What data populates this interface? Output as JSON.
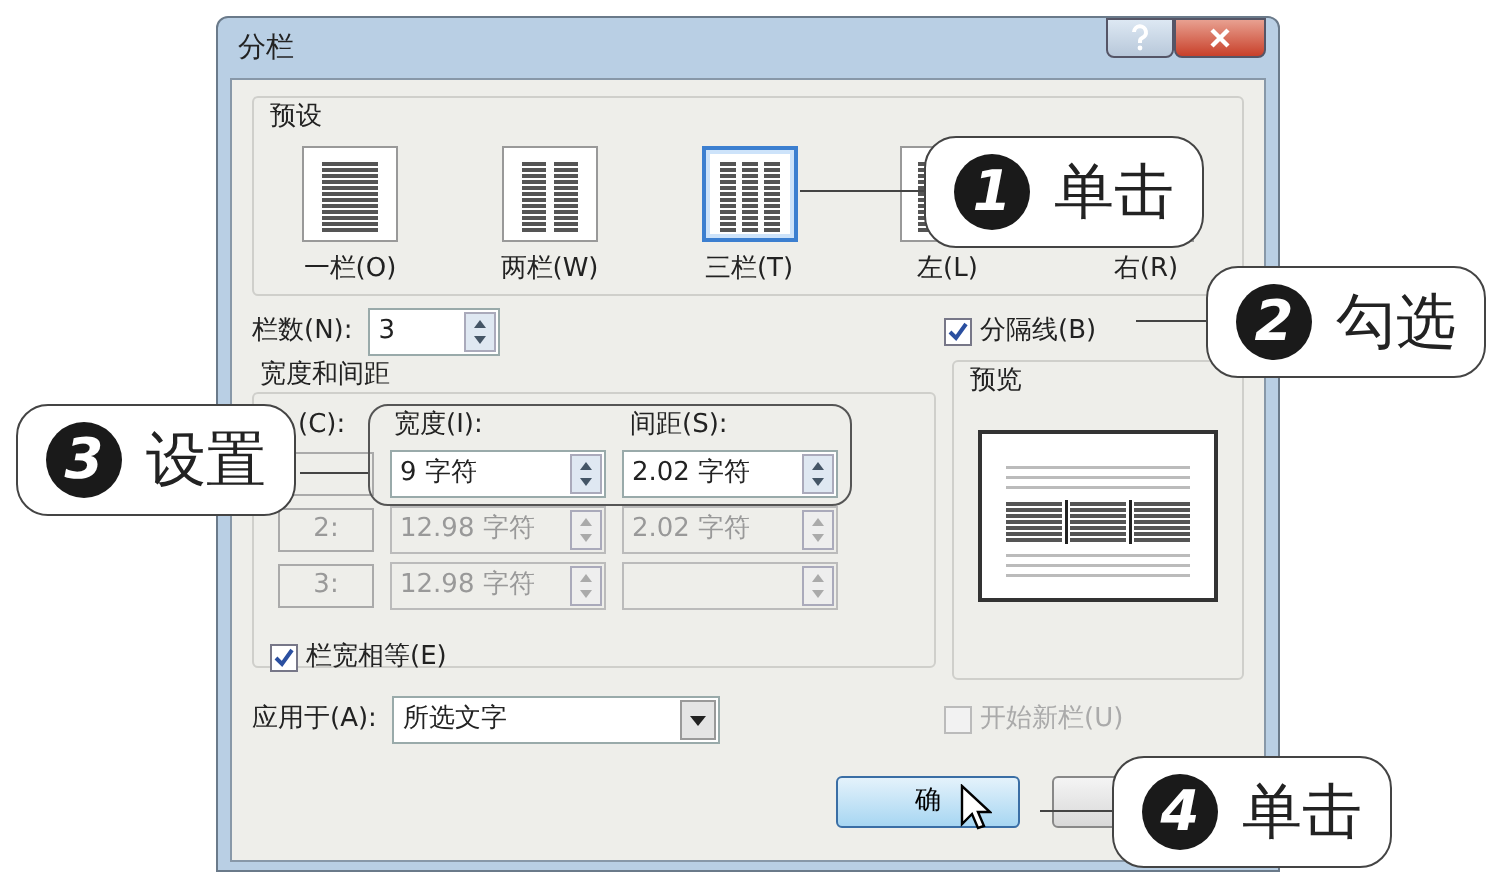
{
  "window": {
    "title": "分栏"
  },
  "presets": {
    "title": "预设",
    "items": [
      {
        "label": "一栏(O)",
        "kind": "one",
        "selected": false
      },
      {
        "label": "两栏(W)",
        "kind": "two",
        "selected": false
      },
      {
        "label": "三栏(T)",
        "kind": "three",
        "selected": true
      },
      {
        "label": "左(L)",
        "kind": "left",
        "selected": false
      },
      {
        "label": "右(R)",
        "kind": "right",
        "selected": false
      }
    ]
  },
  "columns_count": {
    "label": "栏数(N):",
    "value": "3"
  },
  "separator": {
    "label": "分隔线(B)",
    "checked": true
  },
  "width_spacing": {
    "title": "宽度和间距",
    "headers": [
      "(C):",
      "宽度(I):",
      "间距(S):"
    ],
    "rows": [
      {
        "width": "9 字符",
        "spacing": "2.02 字符",
        "disabled": false
      },
      {
        "number": "2:",
        "width": "12.98 字符",
        "spacing": "2.02 字符",
        "disabled": true
      },
      {
        "number": "3:",
        "width": "12.98 字符",
        "disabled": true
      }
    ]
  },
  "equal_width": {
    "label": "栏宽相等(E)",
    "checked": true
  },
  "preview": {
    "title": "预览"
  },
  "apply_to": {
    "label": "应用于(A):",
    "value": "所选文字"
  },
  "start_new_column": {
    "label": "开始新栏(U)",
    "checked": false,
    "disabled": true
  },
  "buttons": [
    {
      "kind": "ok",
      "label": "确"
    },
    {
      "kind": "cancel"
    }
  ],
  "callouts": [
    {
      "number": "1",
      "text": "单击"
    },
    {
      "number": "2",
      "text": "勾选"
    },
    {
      "number": "3",
      "text": "设置"
    },
    {
      "number": "4",
      "text": "单击"
    }
  ]
}
